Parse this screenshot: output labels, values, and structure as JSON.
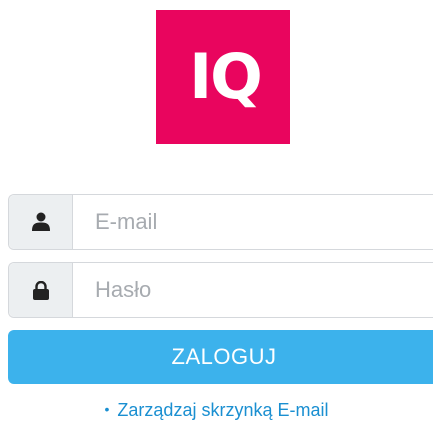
{
  "logo": {
    "text": "IQ",
    "color": "#e9055e"
  },
  "form": {
    "email": {
      "icon": "user-icon",
      "placeholder": "E-mail",
      "value": ""
    },
    "password": {
      "icon": "lock-icon",
      "placeholder": "Hasło",
      "value": ""
    },
    "submit_label": "ZALOGUJ"
  },
  "links": [
    {
      "bullet": "•",
      "label": "Zarządzaj skrzynką E-mail"
    }
  ],
  "colors": {
    "button": "#3cb2ec",
    "link": "#1a8fd1",
    "addon": "#eceff1"
  }
}
